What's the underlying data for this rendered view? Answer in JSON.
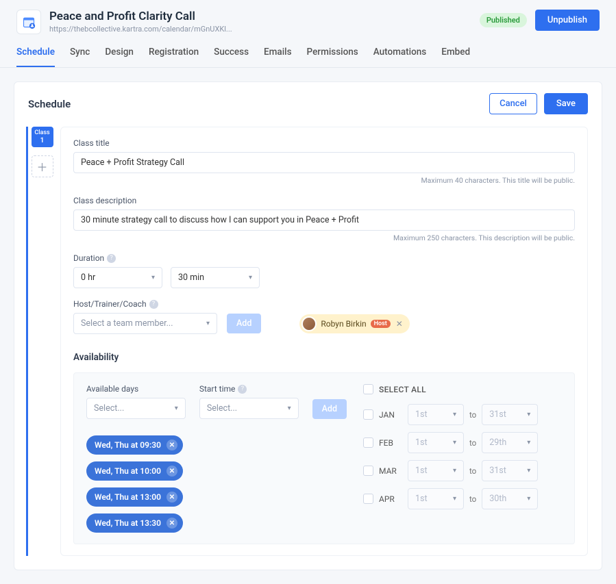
{
  "header": {
    "title": "Peace and Profit Clarity Call",
    "url": "https://thebcollective.kartra.com/calendar/mGnUXKl...",
    "published_label": "Published",
    "unpublish_label": "Unpublish"
  },
  "tabs": [
    "Schedule",
    "Sync",
    "Design",
    "Registration",
    "Success",
    "Emails",
    "Permissions",
    "Automations",
    "Embed"
  ],
  "active_tab_index": 0,
  "card": {
    "title": "Schedule",
    "cancel": "Cancel",
    "save": "Save",
    "class_chip_label": "Class",
    "class_chip_num": "1"
  },
  "form": {
    "class_title_label": "Class title",
    "class_title_value": "Peace + Profit Strategy Call",
    "class_title_hint": "Maximum 40 characters. This title will be public.",
    "class_desc_label": "Class description",
    "class_desc_value": "30 minute strategy call to discuss how I can support you in Peace + Profit",
    "class_desc_hint": "Maximum 250 characters. This description will be public.",
    "duration_label": "Duration",
    "duration_hr": "0 hr",
    "duration_min": "30 min",
    "host_label": "Host/Trainer/Coach",
    "host_placeholder": "Select a team member...",
    "add_label": "Add",
    "host_name": "Robyn Birkin",
    "host_badge": "Host"
  },
  "availability": {
    "heading": "Availability",
    "avail_days_label": "Available days",
    "start_time_label": "Start time",
    "select_placeholder": "Select...",
    "add_label": "Add",
    "slots": [
      "Wed, Thu at 09:30",
      "Wed, Thu at 10:00",
      "Wed, Thu at 13:00",
      "Wed, Thu at 13:30"
    ],
    "select_all": "SELECT ALL",
    "to_label": "to",
    "months": [
      {
        "name": "JAN",
        "from": "1st",
        "to": "31st"
      },
      {
        "name": "FEB",
        "from": "1st",
        "to": "29th"
      },
      {
        "name": "MAR",
        "from": "1st",
        "to": "31st"
      },
      {
        "name": "APR",
        "from": "1st",
        "to": "30th"
      }
    ]
  }
}
